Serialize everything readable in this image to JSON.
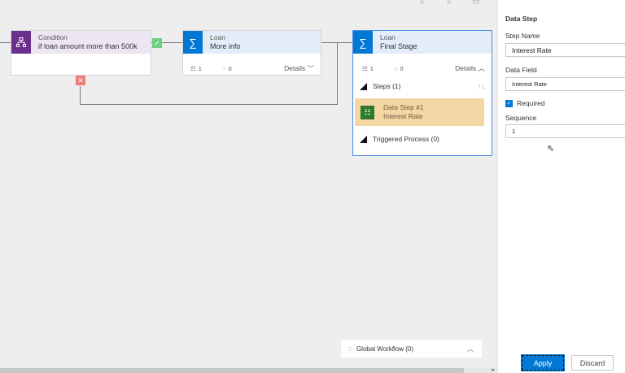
{
  "canvas": {
    "condition_card": {
      "title": "Condition",
      "subtitle": "if loan amount more than 500k",
      "icon": "branch-icon",
      "accent": "#6b2f8e",
      "true_badge": "✓",
      "false_badge": "✕"
    },
    "stage_more_info": {
      "title": "Loan",
      "subtitle": "More info",
      "icon": "stage-icon",
      "steps_count": "1",
      "triggers_count": "0",
      "details_label": "Details",
      "accent": "#0078d4"
    },
    "stage_final": {
      "title": "Loan",
      "subtitle": "Final Stage",
      "icon": "stage-icon",
      "steps_count": "1",
      "triggers_count": "0",
      "details_label": "Details",
      "steps_header": "Steps (1)",
      "data_step_title": "Data Step #1",
      "data_step_subtitle": "Interest Rate",
      "triggered_process": "Triggered Process (0)",
      "accent": "#0078d4"
    },
    "global_workflow": {
      "label": "Global Workflow (0)"
    }
  },
  "panel": {
    "title": "Data Step",
    "step_name_label": "Step Name",
    "step_name_value": "Interest Rate",
    "data_field_label": "Data Field",
    "data_field_value": "Interest Rate",
    "required_label": "Required",
    "required_checked": true,
    "sequence_label": "Sequence",
    "sequence_value": "1",
    "apply_label": "Apply",
    "discard_label": "Discard"
  }
}
